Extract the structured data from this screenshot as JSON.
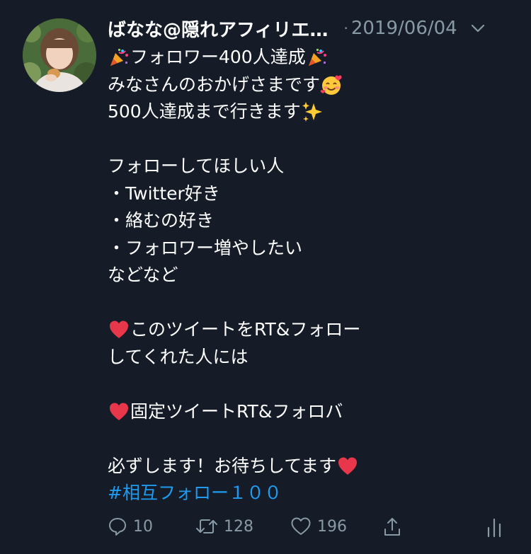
{
  "tweet": {
    "author_name": "ばなな@隠れアフィリエ…",
    "separator": "·",
    "date": "2019/06/04",
    "lines": [
      "フォロワー400人達成",
      "みなさんのおかげさまです",
      "500人達成まで行きます",
      "",
      "フォローしてほしい人",
      "・Twitter好き",
      "・絡むの好き",
      "・フォロワー増やしたい",
      "などなど",
      "",
      "このツイートをRT&フォロー",
      "してくれた人には",
      "",
      "固定ツイートRT&フォロバ",
      "",
      "必ずします！お待ちしてます"
    ],
    "hashtag": "#相互フォロー１００"
  },
  "actions": {
    "reply_count": "10",
    "retweet_count": "128",
    "like_count": "196"
  },
  "colors": {
    "background": "#151c28",
    "text": "#ffffff",
    "muted": "#8899a6",
    "link": "#1d9bf0",
    "heart": "#e0245e"
  },
  "icons": [
    "party-popper-emoji",
    "smiling-face-with-hearts-emoji",
    "sparkles-emoji",
    "red-heart-emoji",
    "reply-icon",
    "retweet-icon",
    "like-icon",
    "share-icon",
    "analytics-icon",
    "chevron-down-icon"
  ]
}
